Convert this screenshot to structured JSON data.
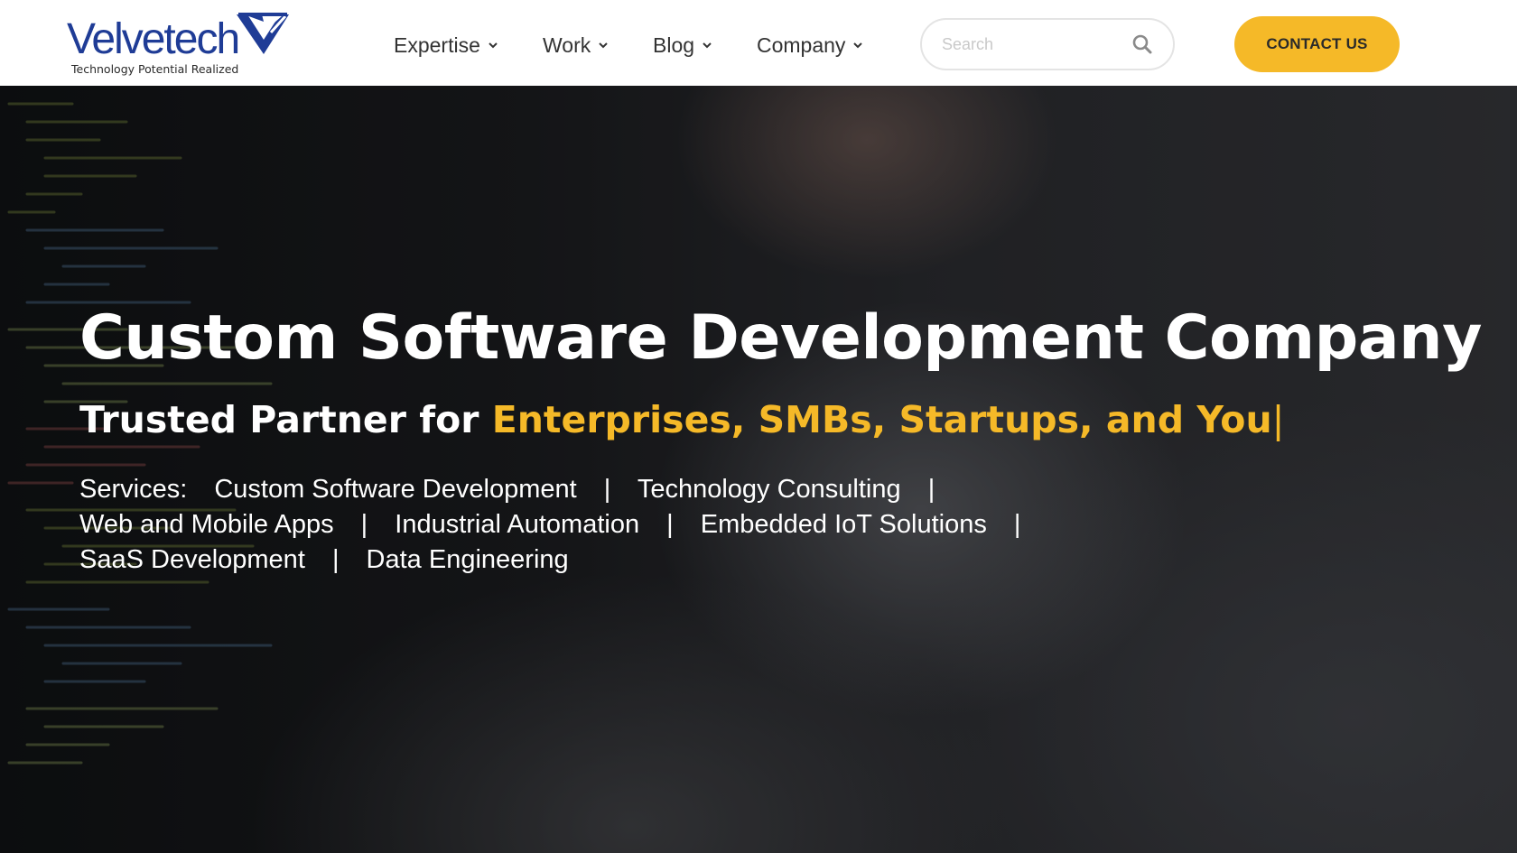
{
  "brand": {
    "name": "Velvetech",
    "tagline": "Technology Potential Realized",
    "color": "#1f3c96"
  },
  "nav": {
    "items": [
      {
        "label": "Expertise",
        "icon": "chevron-down-icon"
      },
      {
        "label": "Work",
        "icon": "chevron-down-icon"
      },
      {
        "label": "Blog",
        "icon": "chevron-down-icon"
      },
      {
        "label": "Company",
        "icon": "chevron-down-icon"
      }
    ]
  },
  "search": {
    "placeholder": "Search",
    "value": "",
    "icon": "search-icon"
  },
  "header": {
    "contact_label": "CONTACT US"
  },
  "hero": {
    "title": "Custom Software Development Company",
    "subtitle_prefix": "Trusted Partner for",
    "subtitle_highlight": "Enterprises, SMBs, Startups, and You",
    "cursor": "|",
    "services_label": "Services:",
    "separator": "|",
    "services": [
      "Custom Software Development",
      "Technology Consulting",
      "Web and Mobile Apps",
      "Industrial Automation",
      "Embedded IoT Solutions",
      "SaaS Development",
      "Data Engineering"
    ]
  },
  "colors": {
    "accent": "#f5b928",
    "hero_text": "#ffffff",
    "nav_text": "#333333"
  }
}
